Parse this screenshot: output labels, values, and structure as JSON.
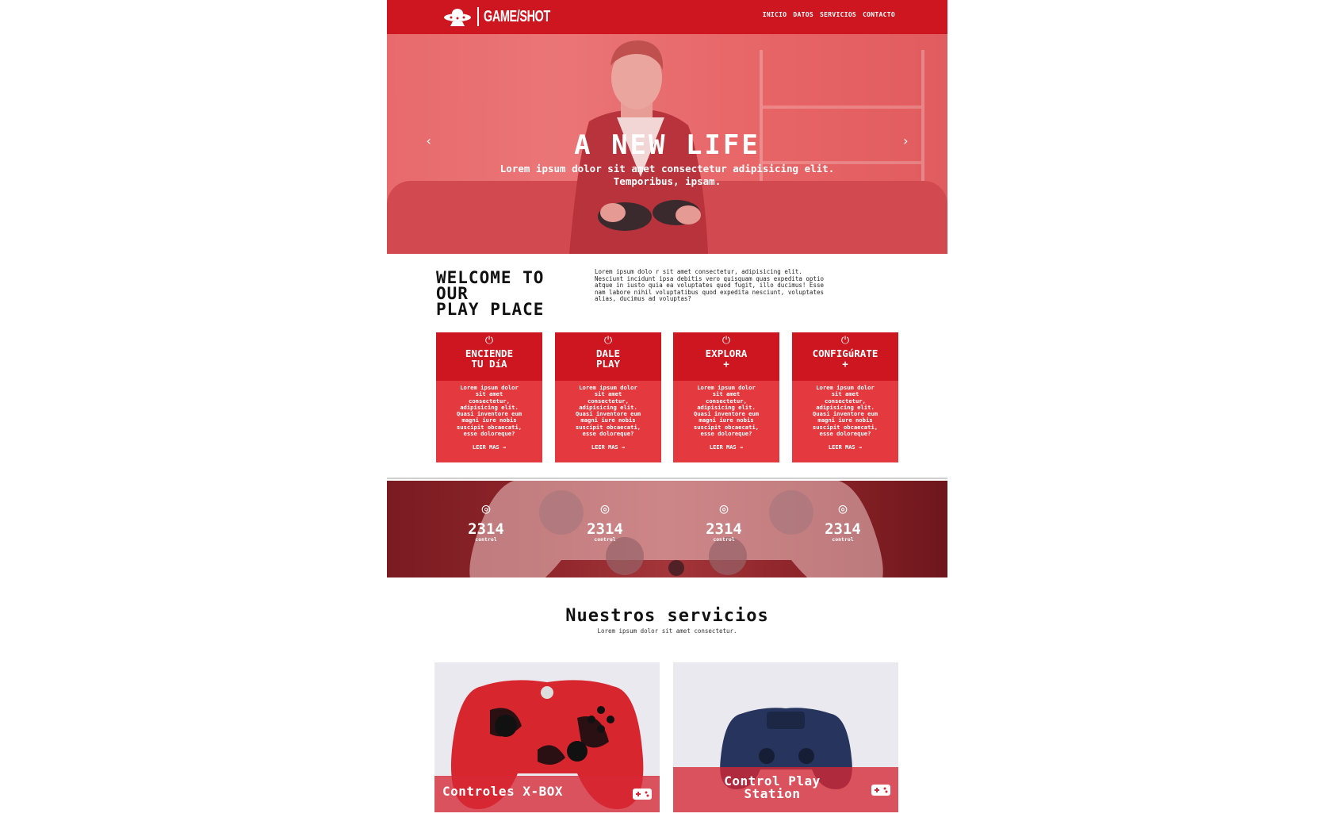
{
  "nav": {
    "logo_text": "GAME/SHOT",
    "links": [
      "INICIO",
      "DATOS",
      "SERVICIOS",
      "CONTACTO"
    ]
  },
  "hero": {
    "title": "A NEW LIFE",
    "subtitle_line1": "Lorem ipsum dolor sit amet consectetur adipisicing elit.",
    "subtitle_line2": "Temporibus, ipsam.",
    "prev_arrow": "‹",
    "next_arrow": "›"
  },
  "welcome": {
    "title_line1": "WELCOME TO",
    "title_line2": "OUR",
    "title_line3": "PLAY PLACE",
    "text_lines": [
      "Lorem ipsum dolo r sit amet consectetur, adipisicing elit.",
      "Nesciunt incidunt ipsa debitis vero quisquam quas expedita optio",
      "atque in iusto quia ea voluptates quod fugit, illo ducimus! Esse",
      "nam labore nihil voluptatibus quod expedita nesciunt, voluptates",
      "alias, ducimus ad voluptas?"
    ]
  },
  "cards": [
    {
      "title_line1": "ENCIENDE",
      "title_line2": "TU DíA",
      "body": [
        "Lorem ipsum dolor",
        "sit amet",
        "consectetur,",
        "adipisicing elit.",
        "Quasi inventore eum",
        "magni iure nobis",
        "suscipit obcaecati,",
        "esse doloreque?"
      ],
      "link": "LEER MAS →"
    },
    {
      "title_line1": "DALE",
      "title_line2": "PLAY",
      "body": [
        "Lorem ipsum dolor",
        "sit amet",
        "consectetur,",
        "adipisicing elit.",
        "Quasi inventore eum",
        "magni iure nobis",
        "suscipit obcaecati,",
        "esse doloreque?"
      ],
      "link": "LEER MAS →"
    },
    {
      "title_line1": "EXPLORA",
      "title_line2": "+",
      "body": [
        "Lorem ipsum dolor",
        "sit amet",
        "consectetur,",
        "adipisicing elit.",
        "Quasi inventore eum",
        "magni iure nobis",
        "suscipit obcaecati,",
        "esse doloreque?"
      ],
      "link": "LEER MAS →"
    },
    {
      "title_line1": "CONFIGúRATE",
      "title_line2": "+",
      "body": [
        "Lorem ipsum dolor",
        "sit amet",
        "consectetur,",
        "adipisicing elit.",
        "Quasi inventore eum",
        "magni iure nobis",
        "suscipit obcaecati,",
        "esse doloreque?"
      ],
      "link": "LEER MAS →"
    }
  ],
  "stats": [
    {
      "value": "2314",
      "label": "control"
    },
    {
      "value": "2314",
      "label": "control"
    },
    {
      "value": "2314",
      "label": "control"
    },
    {
      "value": "2314",
      "label": "control"
    }
  ],
  "services": {
    "title": "Nuestros servicios",
    "subtitle": "Lorem ipsum dolor sit amet consectetur.",
    "items": [
      {
        "label": "Controles X-BOX"
      },
      {
        "label_line1": "Control Play",
        "label_line2": "Station"
      }
    ]
  },
  "colors": {
    "brand_red": "#cd1620",
    "card_red": "#e4393f",
    "stats_dark": "#8c2429"
  }
}
